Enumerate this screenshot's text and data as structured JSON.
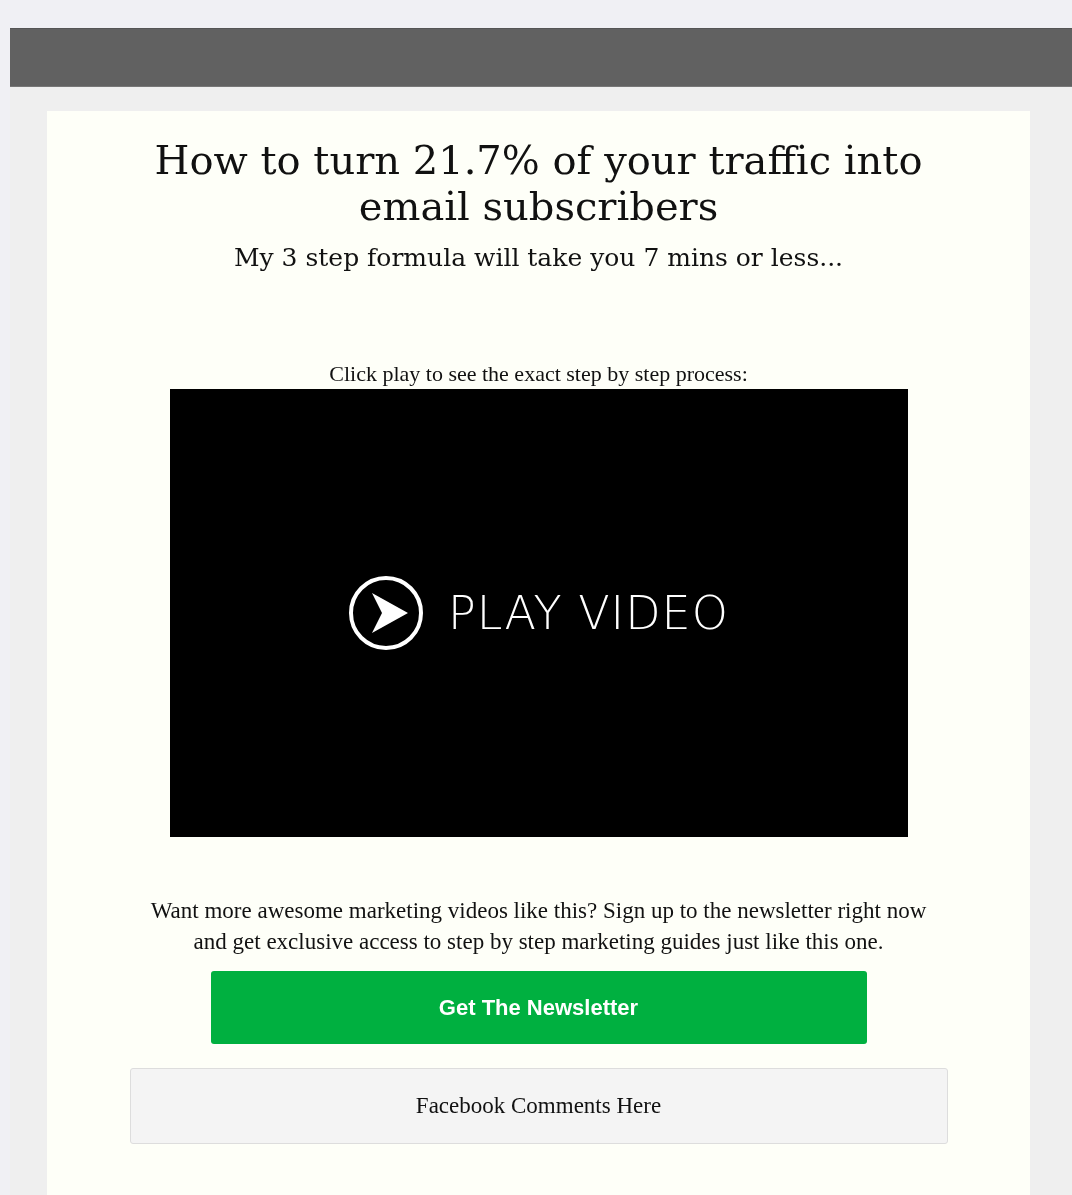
{
  "headline": "How to turn 21.7% of your traffic into email subscribers",
  "subheadline": "My 3 step formula will take you 7 mins or less...",
  "video": {
    "caption": "Click play to see the exact step by step process:",
    "play_label": "PLAY VIDEO"
  },
  "pitch": "Want more awesome marketing videos like this? Sign up to the newsletter right now and get exclusive access to step by step marketing guides just like this one.",
  "cta_button": "Get The Newsletter",
  "comments_placeholder": "Facebook Comments Here"
}
